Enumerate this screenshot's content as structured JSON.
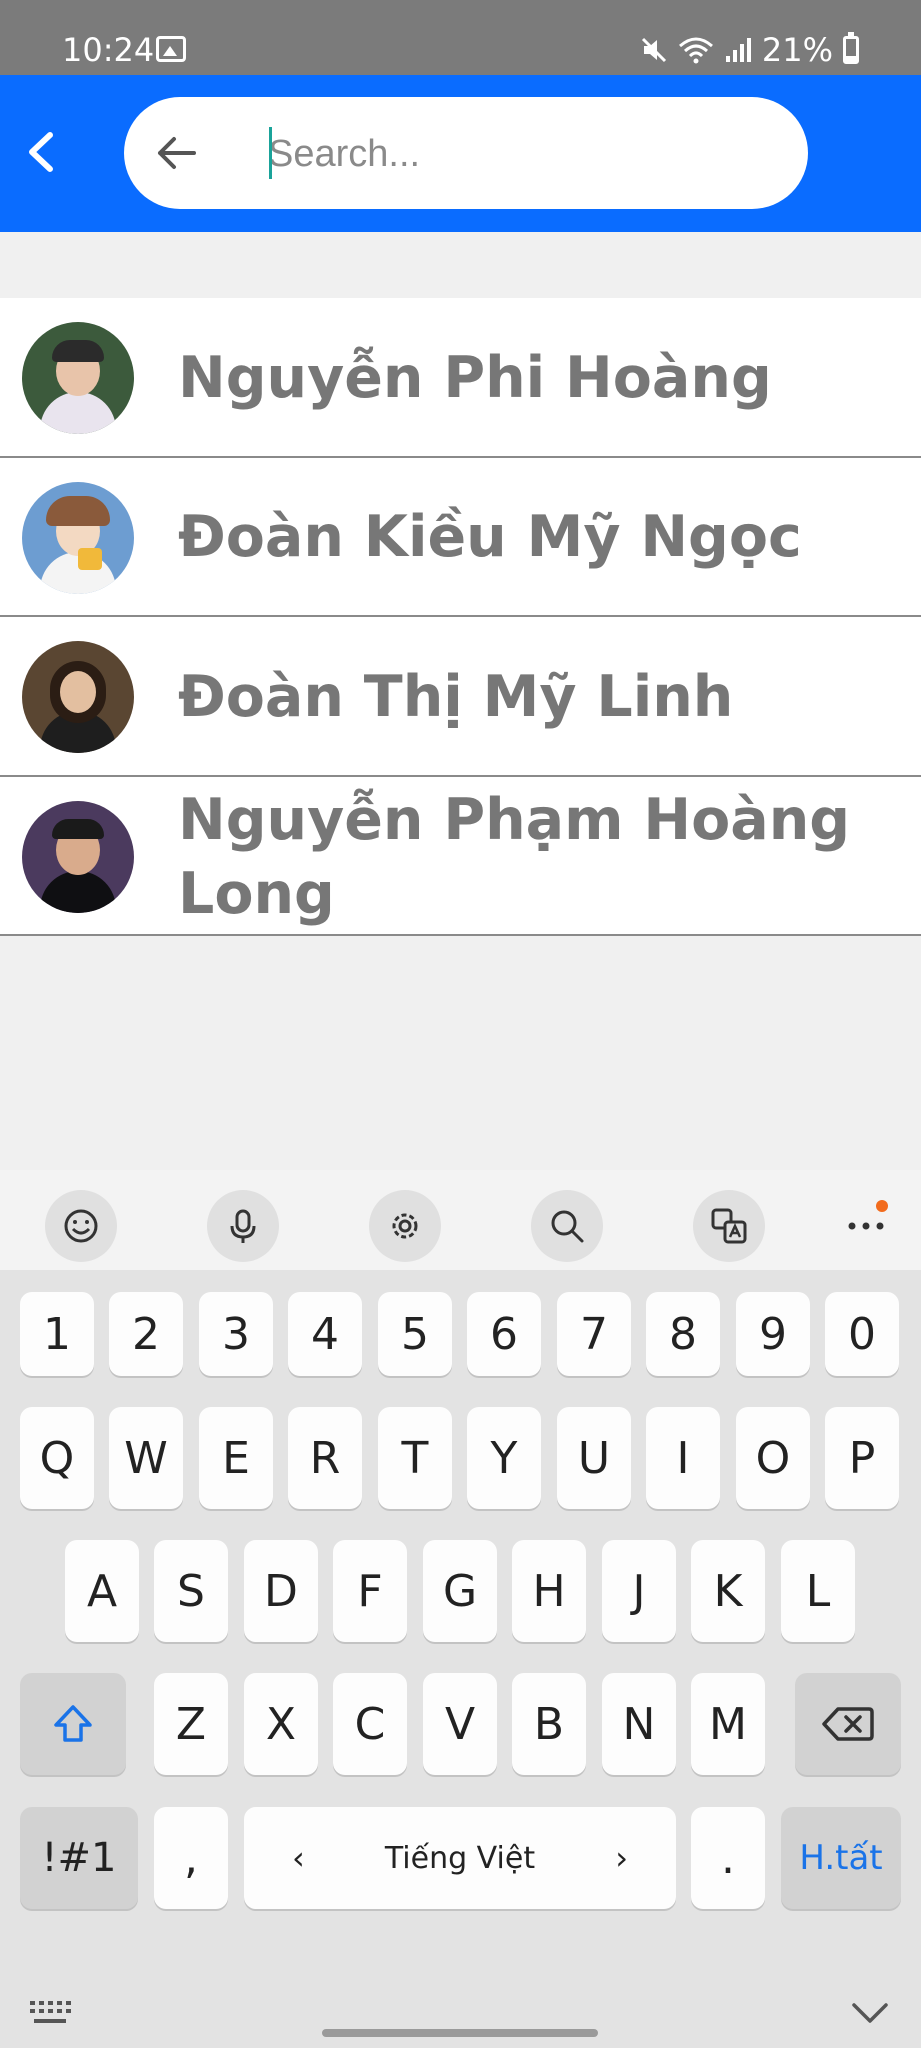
{
  "status_bar": {
    "time": "10:24",
    "battery": "21%"
  },
  "search": {
    "placeholder": "Search..."
  },
  "contacts": [
    {
      "name": "Nguyễn Phi Hoàng"
    },
    {
      "name": "Đoàn Kiều Mỹ Ngọc"
    },
    {
      "name": "Đoàn Thị Mỹ Linh"
    },
    {
      "name": "Nguyễn Phạm Hoàng Long"
    }
  ],
  "keyboard": {
    "toolbar": [
      "emoji-icon",
      "microphone-icon",
      "gear-icon",
      "search-icon",
      "translate-icon",
      "more-icon"
    ],
    "number_row": [
      "1",
      "2",
      "3",
      "4",
      "5",
      "6",
      "7",
      "8",
      "9",
      "0"
    ],
    "row1": [
      "Q",
      "W",
      "E",
      "R",
      "T",
      "Y",
      "U",
      "I",
      "O",
      "P"
    ],
    "row2": [
      "A",
      "S",
      "D",
      "F",
      "G",
      "H",
      "J",
      "K",
      "L"
    ],
    "row3": [
      "Z",
      "X",
      "C",
      "V",
      "B",
      "N",
      "M"
    ],
    "symbols_label": "!#1",
    "comma": ",",
    "space_label": "Tiếng Việt",
    "period": ".",
    "action_label": "H.tất"
  },
  "colors": {
    "appbar": "#0a6cff",
    "name_text": "#777777",
    "action_text": "#1a73e8"
  }
}
